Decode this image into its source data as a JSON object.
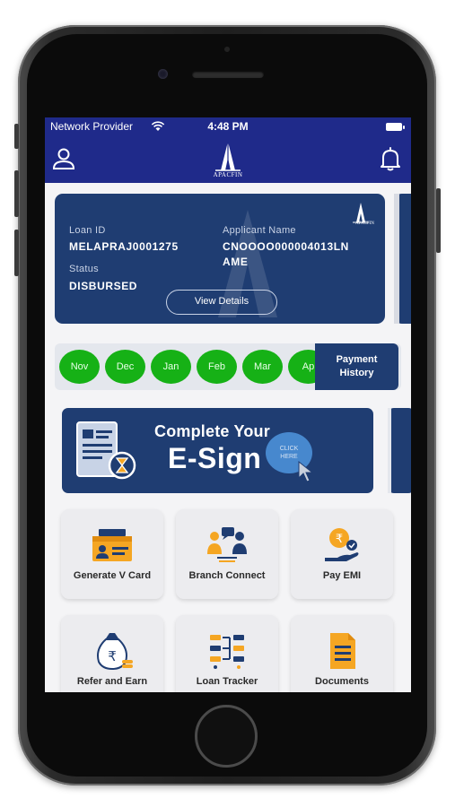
{
  "status_bar": {
    "carrier": "Network Provider",
    "time": "4:48 PM"
  },
  "header": {
    "logo_text": "APACFIN"
  },
  "loan_card": {
    "loan_id_label": "Loan ID",
    "loan_id_value": "MELAPRAJ0001275",
    "applicant_label": "Applicant Name",
    "applicant_value_line1": "CNOOOO000004013LN",
    "applicant_value_line2": "AME",
    "status_label": "Status",
    "status_value": "DISBURSED",
    "view_details_label": "View Details",
    "logo_text": "APACFIN"
  },
  "payments": {
    "months": [
      "Nov",
      "Dec",
      "Jan",
      "Feb",
      "Mar",
      "Ap"
    ],
    "status_color": "#16b116",
    "history_label_line1": "Payment",
    "history_label_line2": "History"
  },
  "esign_banner": {
    "line1": "Complete Your",
    "line2": "E-Sign",
    "click_line1": "CLICK",
    "click_line2": "HERE"
  },
  "tiles": [
    {
      "label": "Generate V Card",
      "icon": "id-card-icon"
    },
    {
      "label": "Branch Connect",
      "icon": "branch-connect-icon"
    },
    {
      "label": "Pay EMI",
      "icon": "rupee-hand-icon"
    },
    {
      "label": "Refer and Earn",
      "icon": "money-bag-icon"
    },
    {
      "label": "Loan Tracker",
      "icon": "tracker-icon"
    },
    {
      "label": "Documents",
      "icon": "document-icon"
    }
  ],
  "colors": {
    "primary_navy": "#1f2a8a",
    "card_blue": "#1f3d72",
    "accent_orange": "#f5a623",
    "paid_green": "#16b116"
  }
}
